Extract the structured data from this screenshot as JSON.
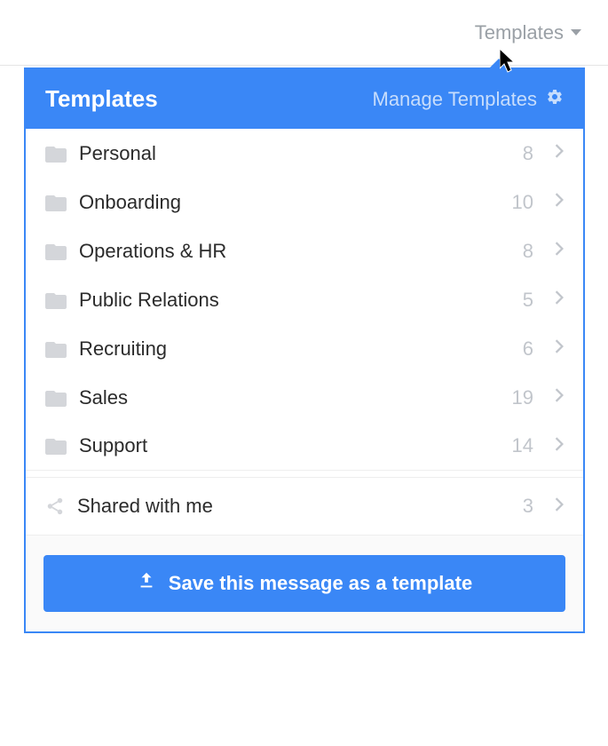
{
  "trigger": {
    "label": "Templates"
  },
  "panel": {
    "title": "Templates",
    "manage_label": "Manage Templates"
  },
  "folders": [
    {
      "label": "Personal",
      "count": 8
    },
    {
      "label": "Onboarding",
      "count": 10
    },
    {
      "label": "Operations & HR",
      "count": 8
    },
    {
      "label": "Public Relations",
      "count": 5
    },
    {
      "label": "Recruiting",
      "count": 6
    },
    {
      "label": "Sales",
      "count": 19
    },
    {
      "label": "Support",
      "count": 14
    }
  ],
  "shared": {
    "label": "Shared with me",
    "count": 3
  },
  "footer": {
    "save_label": "Save this message as a template"
  }
}
